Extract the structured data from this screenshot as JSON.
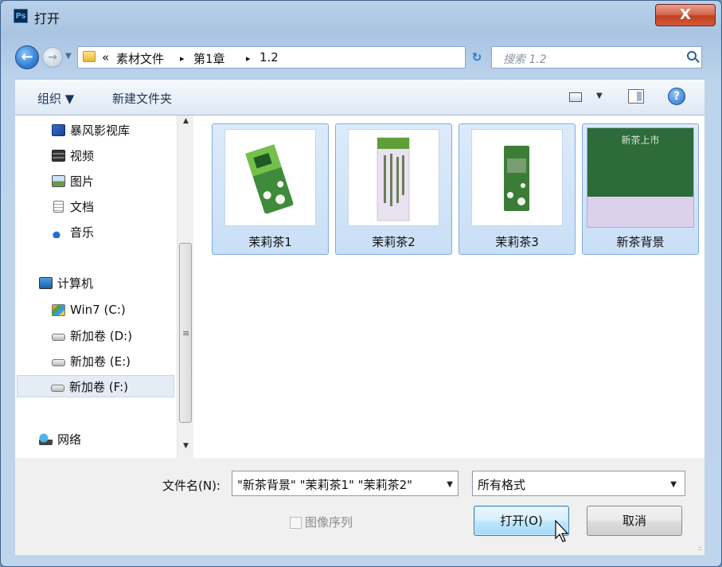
{
  "window": {
    "app_badge": "Ps",
    "title": "打开",
    "close_glyph": "X"
  },
  "nav": {
    "back_glyph": "←",
    "forward_glyph": "→",
    "breadcrumb": {
      "overflow": "«",
      "segments": [
        "素材文件",
        "第1章",
        "1.2"
      ],
      "separator": "▸"
    },
    "search_placeholder": "搜索 1.2"
  },
  "toolbar": {
    "organize_label": "组织 ▼",
    "new_folder_label": "新建文件夹",
    "help_glyph": "?"
  },
  "sidebar": {
    "items": [
      {
        "label": "暴风影视库",
        "icon": "media-library-icon"
      },
      {
        "label": "视频",
        "icon": "video-icon"
      },
      {
        "label": "图片",
        "icon": "pictures-icon"
      },
      {
        "label": "文档",
        "icon": "documents-icon"
      },
      {
        "label": "音乐",
        "icon": "music-icon"
      },
      {
        "label": "计算机",
        "icon": "computer-icon"
      },
      {
        "label": "Win7 (C:)",
        "icon": "system-drive-icon"
      },
      {
        "label": "新加卷 (D:)",
        "icon": "drive-icon"
      },
      {
        "label": "新加卷 (E:)",
        "icon": "drive-icon"
      },
      {
        "label": "新加卷 (F:)",
        "icon": "drive-icon",
        "selected": true
      },
      {
        "label": "网络",
        "icon": "network-icon"
      }
    ]
  },
  "files": [
    {
      "name": "茉莉茶1",
      "selected": true
    },
    {
      "name": "茉莉茶2",
      "selected": true
    },
    {
      "name": "茉莉茶3",
      "selected": true
    },
    {
      "name": "新茶背景",
      "selected": true,
      "thumb_text": "新茶上市"
    }
  ],
  "bottom": {
    "filename_label": "文件名(N):",
    "filename_value": "\"新茶背景\" \"茉莉茶1\" \"茉莉茶2\"",
    "filter_value": "所有格式",
    "image_sequence_label": "图像序列",
    "open_label": "打开(O)",
    "cancel_label": "取消"
  },
  "colors": {
    "accent_blue": "#2a78c8",
    "close_red": "#c2401f",
    "tea_green": "#2e6b3a",
    "lavender": "#dcd0ec"
  }
}
